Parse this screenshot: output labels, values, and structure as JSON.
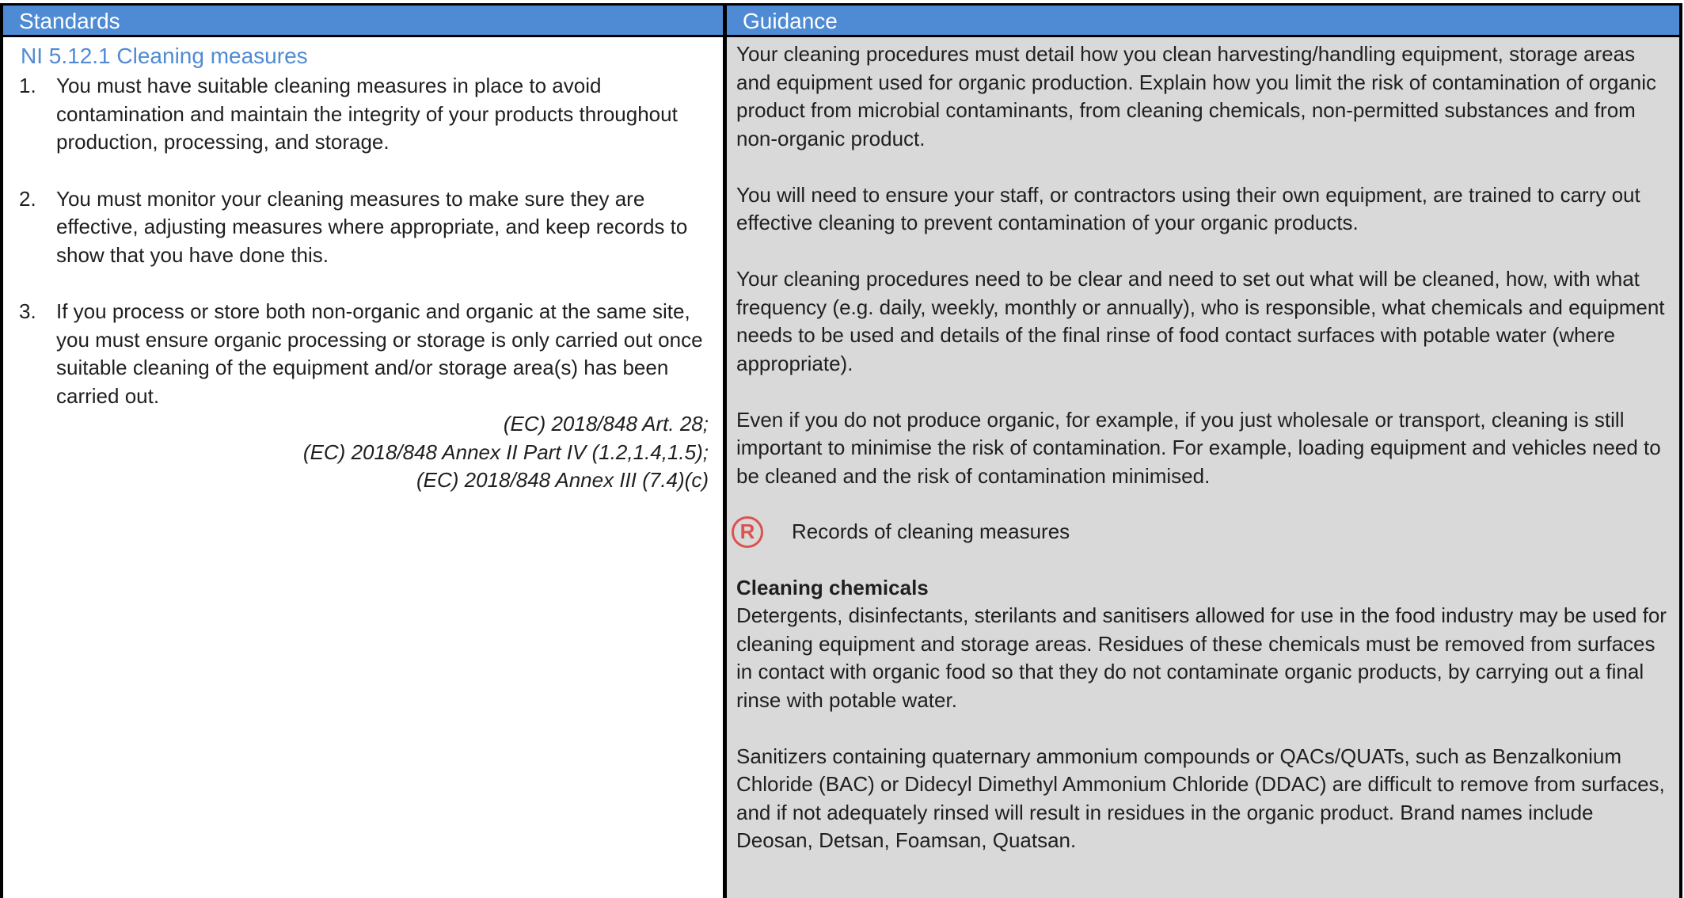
{
  "headers": {
    "standards": "Standards",
    "guidance": "Guidance"
  },
  "standards": {
    "section_title": "NI 5.12.1 Cleaning measures",
    "items": [
      {
        "num": "1.",
        "text": "You must have suitable cleaning measures in place to avoid contamination and maintain the integrity of your products throughout production, processing, and storage."
      },
      {
        "num": "2.",
        "text": "You must monitor your cleaning measures to make sure they are effective, adjusting measures where appropriate, and keep records to show that you have done this."
      },
      {
        "num": "3.",
        "text": "If you process or store both non-organic and organic at the same site, you must ensure organic processing or storage is only carried out once suitable cleaning of the equipment and/or storage area(s) has been carried out."
      }
    ],
    "references": [
      "(EC) 2018/848 Art. 28;",
      "(EC) 2018/848 Annex II Part IV (1.2,1.4,1.5);",
      "(EC) 2018/848 Annex III (7.4)(c)"
    ]
  },
  "guidance": {
    "paragraphs": [
      "Your cleaning procedures must detail how you clean harvesting/handling equipment, storage areas and equipment used for organic production. Explain how you limit the risk of contamination of organic product from microbial contaminants, from cleaning chemicals, non-permitted substances and from non-organic product.",
      "You will need to ensure your staff, or contractors using their own equipment, are trained to carry out effective cleaning to prevent contamination of your organic products.",
      "Your cleaning procedures need to be clear and need to set out what will be cleaned, how, with what frequency (e.g. daily, weekly, monthly or annually), who is responsible, what chemicals and equipment needs to be used and details of the final rinse of food contact surfaces with potable water (where appropriate).",
      "Even if you do not produce organic, for example, if you just wholesale or transport, cleaning is still important to minimise the risk of contamination. For example, loading equipment and vehicles need to be cleaned and the risk of contamination minimised."
    ],
    "records_icon_letter": "R",
    "records_label": "Records of cleaning measures",
    "chemicals_heading": "Cleaning chemicals",
    "chemicals_paragraphs": [
      "Detergents, disinfectants, sterilants and sanitisers allowed for use in the food industry may be used for cleaning equipment and storage areas. Residues of these chemicals must be removed from surfaces in contact with organic food so that they do not contaminate organic products, by carrying out a final rinse with potable water.",
      "Sanitizers containing quaternary ammonium compounds or QACs/QUATs, such as Benzalkonium Chloride (BAC) or Didecyl Dimethyl Ammonium Chloride (DDAC) are difficult to remove from surfaces, and if not adequately rinsed will result in residues in the organic product. Brand names include Deosan, Detsan, Foamsan, Quatsan."
    ]
  },
  "colors": {
    "header_bg": "#4f8bd4",
    "guidance_bg": "#d9d9d9",
    "records_icon": "#d9534f"
  }
}
